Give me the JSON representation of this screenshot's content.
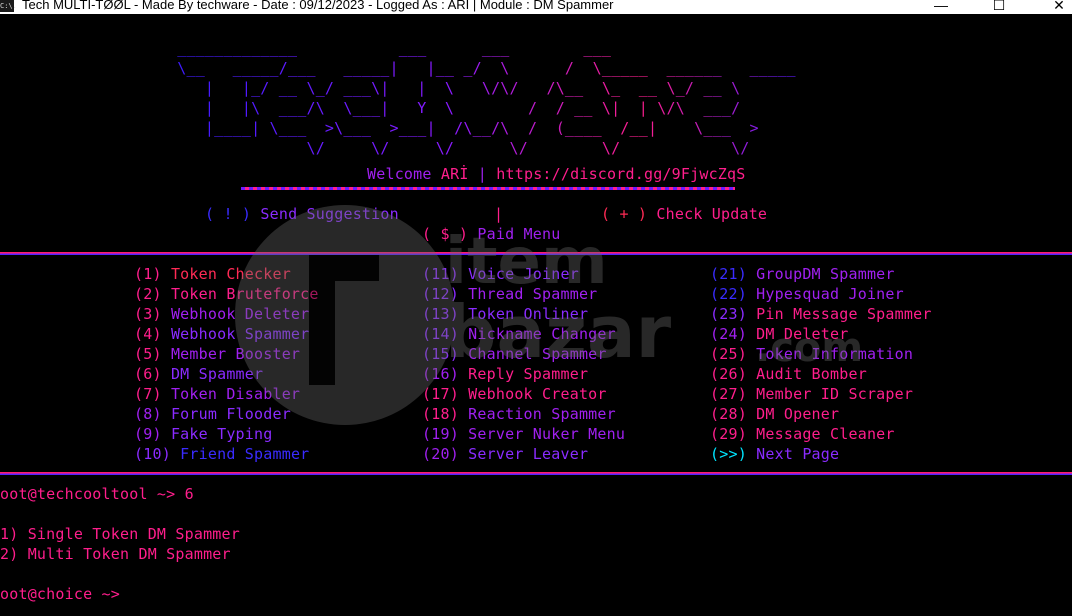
{
  "window": {
    "title": "Tech MULTI-TØØL - Made By techware - Date : 09/12/2023 - Logged As : ARİ | Module : DM Spammer",
    "icon": "C:\\.",
    "minimize": "—",
    "maximize": "☐",
    "close": "✕"
  },
  "banner": {
    "art": " _____________           ___      ___        ___\n \\__   _____/___   _____|   |__ _/  \\      /  \\_____  ______   _____\n    |   |_/ __ \\_/ ___\\|   |  \\   \\/\\/   /\\__  \\_  __ \\_/ __ \\\n    |   |\\  ___/\\  \\___|   Y  \\        /  / __ \\|  | \\/\\  ___/\n    |____| \\___  >\\___  >___|  /\\__/\\  /  (____  /__|    \\___  >\n               \\/     \\/     \\/      \\/        \\/            \\/",
    "welcome_label": "Welcome",
    "welcome_user": "ARİ",
    "welcome_sep": "|",
    "discord_link": "https://discord.gg/9FjwcZqS"
  },
  "top_menu": {
    "suggest_icon": "( ! )",
    "suggest_label": "Send Suggestion",
    "divider": "|",
    "update_icon": "( + )",
    "update_label": "Check Update",
    "paid_icon": "( $ )",
    "paid_label": "Paid Menu"
  },
  "menu": {
    "col1": [
      {
        "num": "(1)",
        "label": "Token Checker"
      },
      {
        "num": "(2)",
        "label": "Token Bruteforce"
      },
      {
        "num": "(3)",
        "label": "Webhook Deleter"
      },
      {
        "num": "(4)",
        "label": "Webhook Spammer"
      },
      {
        "num": "(5)",
        "label": "Member Booster"
      },
      {
        "num": "(6)",
        "label": "DM Spammer"
      },
      {
        "num": "(7)",
        "label": "Token Disabler"
      },
      {
        "num": "(8)",
        "label": "Forum Flooder"
      },
      {
        "num": "(9)",
        "label": "Fake Typing"
      },
      {
        "num": "(10)",
        "label": "Friend Spammer"
      }
    ],
    "col2": [
      {
        "num": "(11)",
        "label": "Voice Joiner"
      },
      {
        "num": "(12)",
        "label": "Thread Spammer"
      },
      {
        "num": "(13)",
        "label": "Token Onliner"
      },
      {
        "num": "(14)",
        "label": "Nickname Changer"
      },
      {
        "num": "(15)",
        "label": "Channel Spammer"
      },
      {
        "num": "(16)",
        "label": "Reply Spammer"
      },
      {
        "num": "(17)",
        "label": "Webhook Creator"
      },
      {
        "num": "(18)",
        "label": "Reaction Spammer"
      },
      {
        "num": "(19)",
        "label": "Server Nuker Menu"
      },
      {
        "num": "(20)",
        "label": "Server Leaver"
      }
    ],
    "col3": [
      {
        "num": "(21)",
        "label": "GroupDM Spammer"
      },
      {
        "num": "(22)",
        "label": "Hypesquad Joiner"
      },
      {
        "num": "(23)",
        "label": "Pin Message Spammer"
      },
      {
        "num": "(24)",
        "label": "DM Deleter"
      },
      {
        "num": "(25)",
        "label": "Token Information"
      },
      {
        "num": "(26)",
        "label": "Audit Bomber"
      },
      {
        "num": "(27)",
        "label": "Member ID Scraper"
      },
      {
        "num": "(28)",
        "label": "DM Opener"
      },
      {
        "num": "(29)",
        "label": "Message Cleaner"
      },
      {
        "num": "(>>)",
        "label": "Next Page"
      }
    ]
  },
  "console": {
    "prompt1": "oot@techcooltool ~> 6",
    "option1": "1) Single Token DM Spammer",
    "option2": "2) Multi Token DM Spammer",
    "prompt2": "oot@choice ~>"
  },
  "watermark": {
    "line1": "item",
    "line2": "bazar",
    "line3": ".com"
  }
}
